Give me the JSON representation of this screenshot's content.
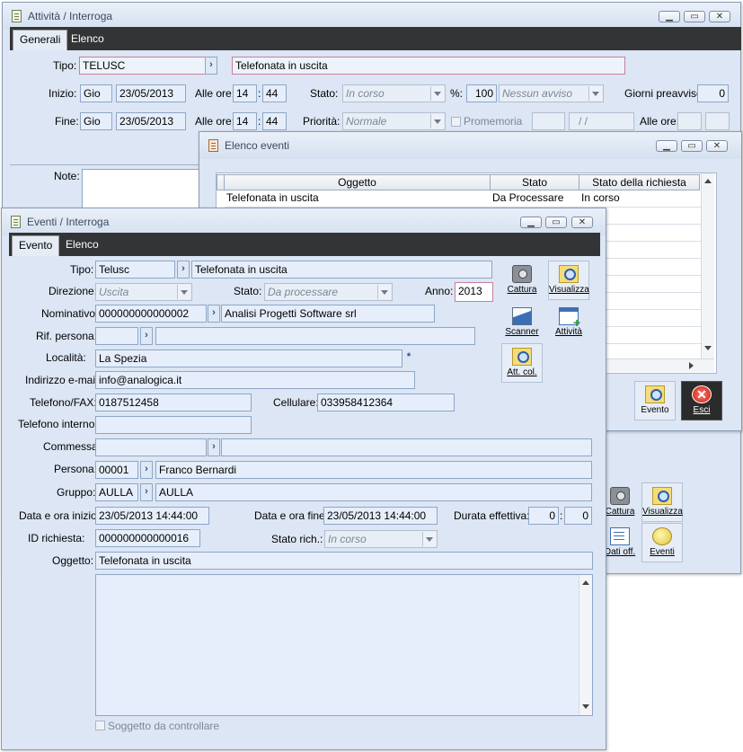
{
  "attivita": {
    "title": "Attività / Interroga",
    "tabs": [
      "Generali",
      "Elenco"
    ],
    "tipo_label": "Tipo:",
    "tipo_code": "TELUSC",
    "tipo_desc": "Telefonata in uscita",
    "inizio_label": "Inizio:",
    "inizio_day": "Gio",
    "inizio_date": "23/05/2013",
    "alle_ore_label": "Alle ore:",
    "inizio_hh": "14",
    "inizio_mm": "44",
    "stato_label": "Stato:",
    "stato_value": "In corso",
    "pct_label": "%:",
    "pct_value": "100",
    "avviso_value": "Nessun avviso",
    "giorni_label": "Giorni preavviso:",
    "giorni_value": "0",
    "fine_label": "Fine:",
    "fine_day": "Gio",
    "fine_date": "23/05/2013",
    "fine_hh": "14",
    "fine_mm": "44",
    "priorita_label": "Priorità:",
    "priorita_value": "Normale",
    "promemoria_label": "Promemoria",
    "promemoria_date": "/ /",
    "alle_ore2_label": "Alle ore:",
    "note_label": "Note:"
  },
  "elenco": {
    "title": "Elenco eventi",
    "columns": [
      "Oggetto",
      "Stato",
      "Stato della richiesta"
    ],
    "rows": [
      {
        "oggetto": "Telefonata in uscita",
        "stato": "Da Processare",
        "richiesta": "In corso"
      }
    ],
    "evento_btn": "Evento",
    "esci_btn": "Esci"
  },
  "eventi": {
    "title": "Eventi / Interroga",
    "tabs": [
      "Evento",
      "Elenco"
    ],
    "tipo_label": "Tipo:",
    "tipo_code": "Telusc",
    "tipo_desc": "Telefonata in uscita",
    "direzione_label": "Direzione:",
    "direzione_value": "Uscita",
    "stato_label": "Stato:",
    "stato_value": "Da processare",
    "anno_label": "Anno:",
    "anno_value": "2013",
    "nominativo_label": "Nominativo:",
    "nominativo_code": "000000000000002",
    "nominativo_desc": "Analisi Progetti Software srl",
    "rif_label": "Rif. persona:",
    "localita_label": "Località:",
    "localita_value": "La Spezia",
    "email_label": "Indirizzo e-mail:",
    "email_value": "info@analogica.it",
    "telefono_label": "Telefono/FAX:",
    "telefono_value": "0187512458",
    "cellulare_label": "Cellulare:",
    "cellulare_value": "033958412364",
    "interno_label": "Telefono interno:",
    "commessa_label": "Commessa:",
    "persona_label": "Persona:",
    "persona_code": "00001",
    "persona_name": "Franco  Bernardi",
    "gruppo_label": "Gruppo:",
    "gruppo_code": "AULLA",
    "gruppo_desc": "AULLA",
    "dt_inizio_label": "Data e ora inizio:",
    "dt_inizio_value": "23/05/2013 14:44:00",
    "dt_fine_label": "Data e ora fine:",
    "dt_fine_value": "23/05/2013 14:44:00",
    "durata_label": "Durata effettiva:",
    "durata_h": "0",
    "durata_m": "0",
    "idric_label": "ID richiesta:",
    "idric_value": "000000000000016",
    "statoric_label": "Stato  rich.:",
    "statoric_value": "In corso",
    "oggetto_label": "Oggetto:",
    "oggetto_value": "Telefonata in uscita",
    "soggetto_label": "Soggetto da controllare",
    "btn_cattura": "Cattura",
    "btn_visualizza": "Visualizza",
    "btn_scanner": "Scanner",
    "btn_attivita": "Attività",
    "btn_attcol": "Att. col."
  },
  "bg_buttons": {
    "cattura": "Cattura",
    "visualizza": "Visualizza",
    "datioff": "Dati off.",
    "eventi": "Eventi"
  }
}
